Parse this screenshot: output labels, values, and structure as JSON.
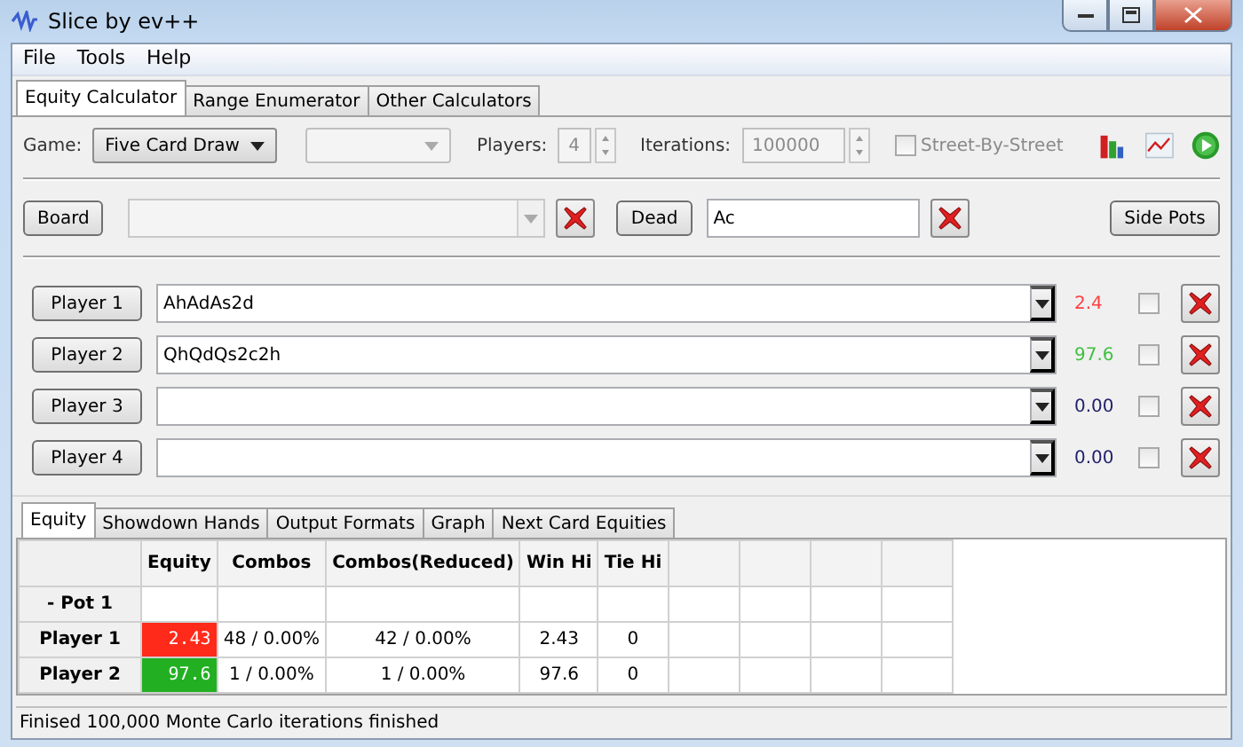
{
  "window": {
    "title": "Slice by ev++"
  },
  "menu": [
    "File",
    "Tools",
    "Help"
  ],
  "tabs": [
    {
      "label": "Equity Calculator",
      "selected": true
    },
    {
      "label": "Range Enumerator",
      "selected": false
    },
    {
      "label": "Other Calculators",
      "selected": false
    }
  ],
  "settings": {
    "game_label": "Game:",
    "game": "Five Card Draw",
    "players_label": "Players:",
    "players": "4",
    "iterations_label": "Iterations:",
    "iterations": "100000",
    "street_by_street": {
      "label": "Street-By-Street",
      "checked": false
    }
  },
  "board": {
    "button": "Board",
    "dead_button": "Dead",
    "dead": "Ac",
    "side_pots": "Side Pots"
  },
  "players": [
    {
      "button": "Player 1",
      "hand": "AhAdAs2d",
      "equity": "2.4",
      "color": "#ff4040",
      "checked": false
    },
    {
      "button": "Player 2",
      "hand": "QhQdQs2c2h",
      "equity": "97.6",
      "color": "#40c040",
      "checked": false
    },
    {
      "button": "Player 3",
      "equity": "0.00",
      "color": "#20206a",
      "checked": false
    },
    {
      "button": "Player 4",
      "equity": "0.00",
      "color": "#20206a",
      "checked": false
    }
  ],
  "result_tabs": [
    {
      "label": "Equity",
      "selected": true
    },
    {
      "label": "Showdown Hands",
      "selected": false
    },
    {
      "label": "Output Formats",
      "selected": false
    },
    {
      "label": "Graph",
      "selected": false
    },
    {
      "label": "Next Card Equities",
      "selected": false
    }
  ],
  "table": {
    "columns": [
      "Equity",
      "Combos",
      "Combos(Reduced)",
      "Win Hi",
      "Tie Hi"
    ],
    "rows": [
      {
        "label": "- Pot 1"
      },
      {
        "label": "Player 1",
        "equity": "2.43",
        "color": "#ff2a1a",
        "combos": "48 / 0.00%",
        "combos_reduced": "42 / 0.00%",
        "win_hi": "2.43",
        "tie_hi": "0"
      },
      {
        "label": "Player 2",
        "equity": "97.6",
        "color": "#22b022",
        "combos": "1 / 0.00%",
        "combos_reduced": "1 / 0.00%",
        "win_hi": "97.6",
        "tie_hi": "0"
      }
    ]
  },
  "status_bar": "Finised 100,000 Monte Carlo iterations finished"
}
